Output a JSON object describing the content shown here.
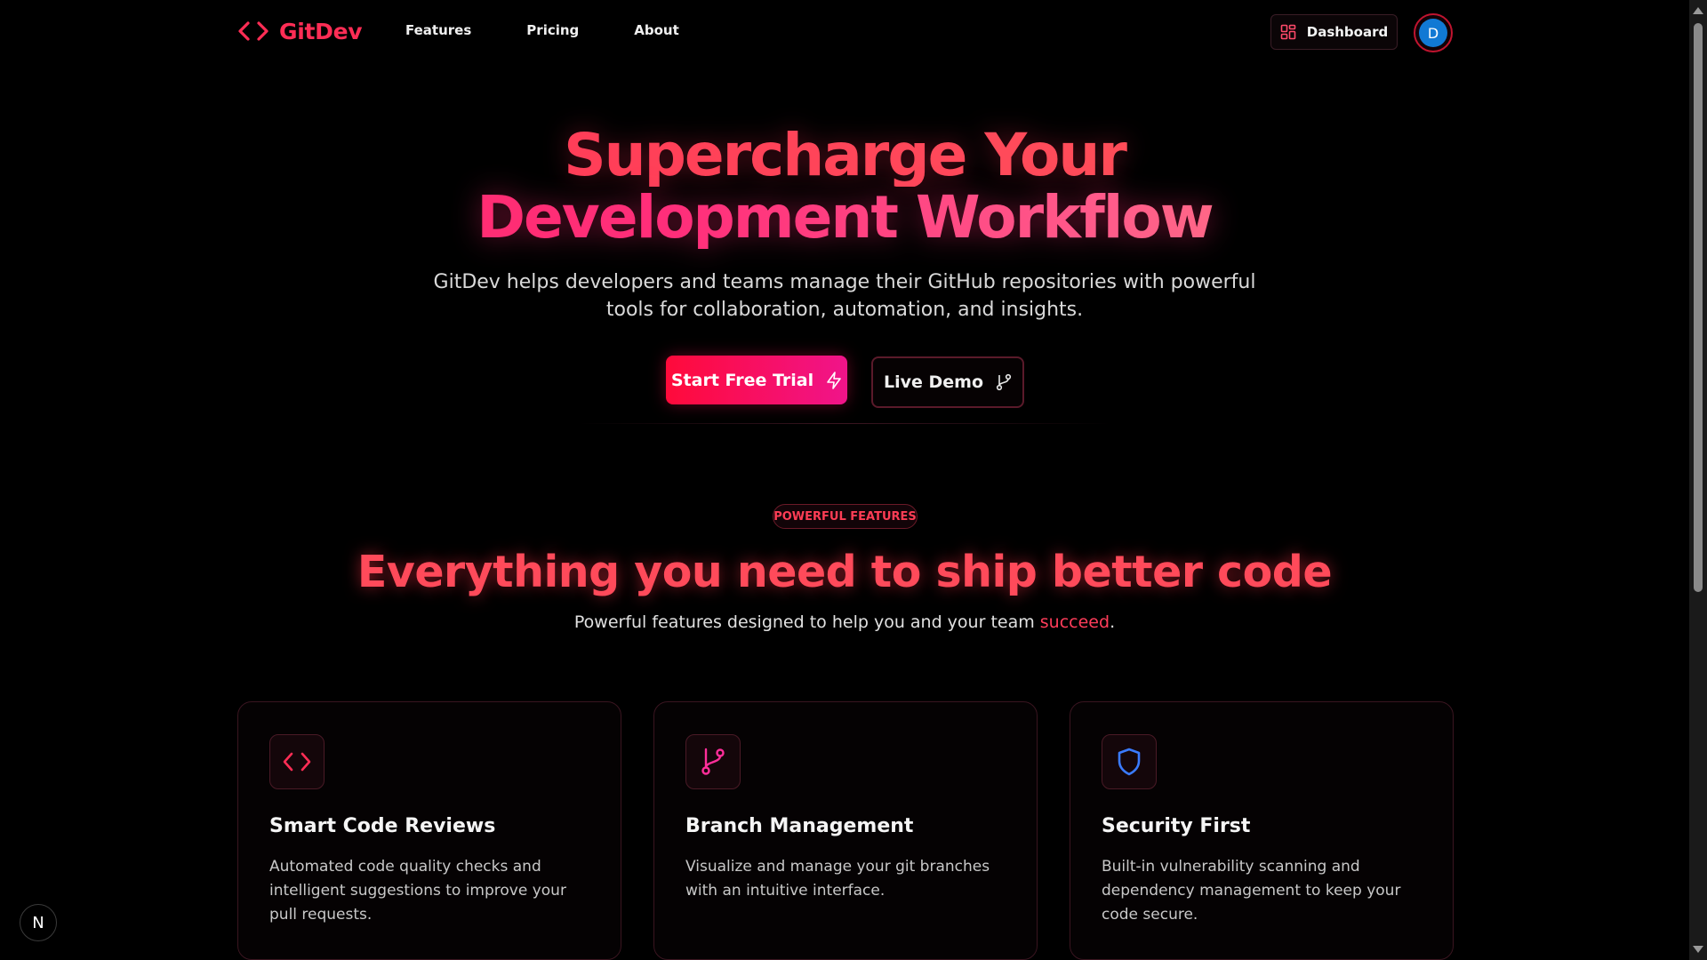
{
  "nav": {
    "brand": "GitDev",
    "links": [
      "Features",
      "Pricing",
      "About"
    ],
    "dashboard_label": "Dashboard",
    "avatar_initial": "D"
  },
  "hero": {
    "title_line1": "Supercharge Your",
    "title_line2": "Development Workflow",
    "subtitle_line1": "GitDev helps developers and teams manage their GitHub repositories with powerful",
    "subtitle_line2": "tools for collaboration, automation, and insights.",
    "primary_cta": "Start Free Trial",
    "secondary_cta": "Live Demo"
  },
  "features": {
    "badge": "POWERFUL FEATURES",
    "title": "Everything you need to ship better code",
    "subtitle_prefix": "Powerful features designed to help you and your team ",
    "subtitle_accent": "succeed",
    "subtitle_suffix": ".",
    "cards": [
      {
        "icon": "code-icon",
        "title": "Smart Code Reviews",
        "description": "Automated code quality checks and intelligent suggestions to improve your pull requests."
      },
      {
        "icon": "git-branch-icon",
        "title": "Branch Management",
        "description": "Visualize and manage your git branches with an intuitive interface."
      },
      {
        "icon": "shield-icon",
        "title": "Security First",
        "description": "Built-in vulnerability scanning and dependency management to keep your code secure."
      }
    ]
  },
  "dev_badge": "N",
  "colors": {
    "brand": "#ff2d55",
    "accent_pink": "#f0148a",
    "avatar_blue": "#1179d4",
    "shield_blue": "#3a7bff"
  }
}
